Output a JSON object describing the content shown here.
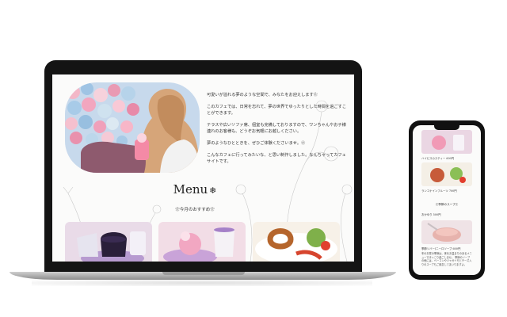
{
  "laptop": {
    "hero_paragraphs": [
      "可愛いが溢れる夢のような空間で、みなたをお迎えします❀",
      "このカフェでは、日常を忘れて、夢の世界でゆったりとした時間を過ごすことができます。",
      "テラスや広いソファ席、個室も完備しておりますので、ワンちゃんやお子様連れのお客様も、どうぞお気軽にお越しください。",
      "夢のようなひとときを、ぜひご体験くださいませ。❀",
      "こんなカフェに行ってみたいな、と思い制作しました。なんちゃってカフェサイトです。"
    ],
    "menu_title": "Menu",
    "menu_icon": "❄",
    "menu_subtitle": "❀今月のおすすめ❀"
  },
  "phone": {
    "caption_1": "ハイビスカスティー 600円",
    "caption_2": "ランコナインフルーツ 700円",
    "section_1": "❀季節のスープ❀",
    "caption_3": "おかゆり 500円",
    "caption_4": "季節ソバー(ニーロソープ 600円",
    "paragraph": "冬のお寒の季節は、体をお温まりのあるメニューでほっこり過ごしませ。 季節のソープの他には、ベーコンやジャガイモとチーズ入りのスープもご用意してまいりますよ。"
  },
  "colors": {
    "laptop_frame": "#141414",
    "screen_bg": "#fbfbfa",
    "text": "#333333"
  }
}
